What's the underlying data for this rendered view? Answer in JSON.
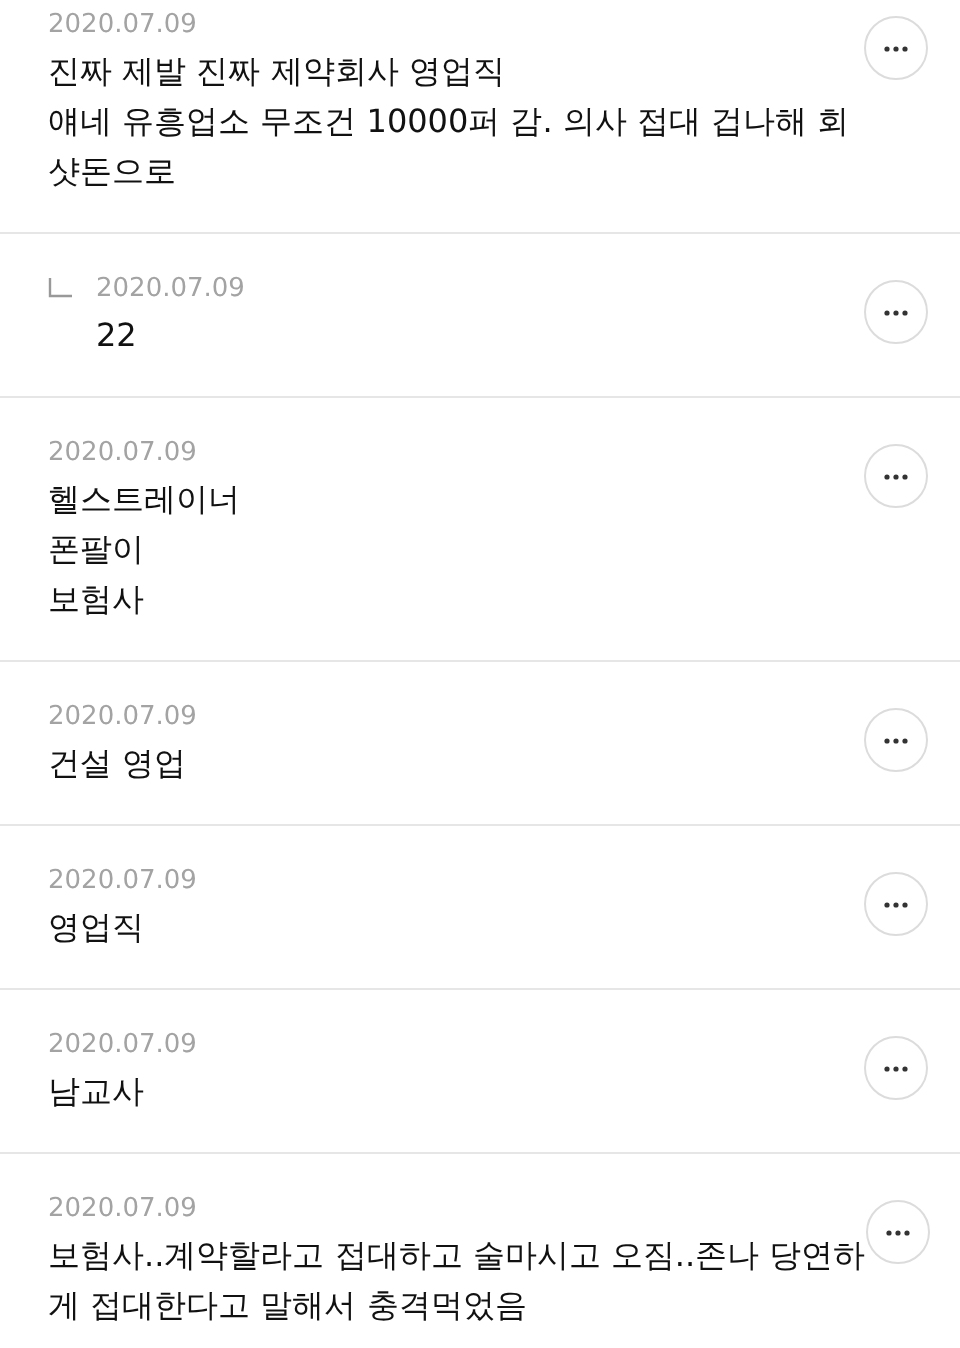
{
  "comments": [
    {
      "kind": "comment",
      "date": "2020.07.09",
      "body": "진짜 제발 진짜 제약회사 영업직\n얘네 유흥업소 무조건 10000퍼 감. 의사 접대 겁나해 회\n샷돈으로"
    },
    {
      "kind": "reply",
      "date": "2020.07.09",
      "body": "22"
    },
    {
      "kind": "comment",
      "date": "2020.07.09",
      "body": "헬스트레이너\n폰팔이\n보험사"
    },
    {
      "kind": "comment",
      "date": "2020.07.09",
      "body": "건설 영업"
    },
    {
      "kind": "comment",
      "date": "2020.07.09",
      "body": "영업직"
    },
    {
      "kind": "comment",
      "date": "2020.07.09",
      "body": "남교사"
    },
    {
      "kind": "comment",
      "date": "2020.07.09",
      "body": "보험사..계약할라고 접대하고 술마시고 오짐..존나 당연하\n게 접대한다고 말해서 충격먹었음"
    }
  ]
}
